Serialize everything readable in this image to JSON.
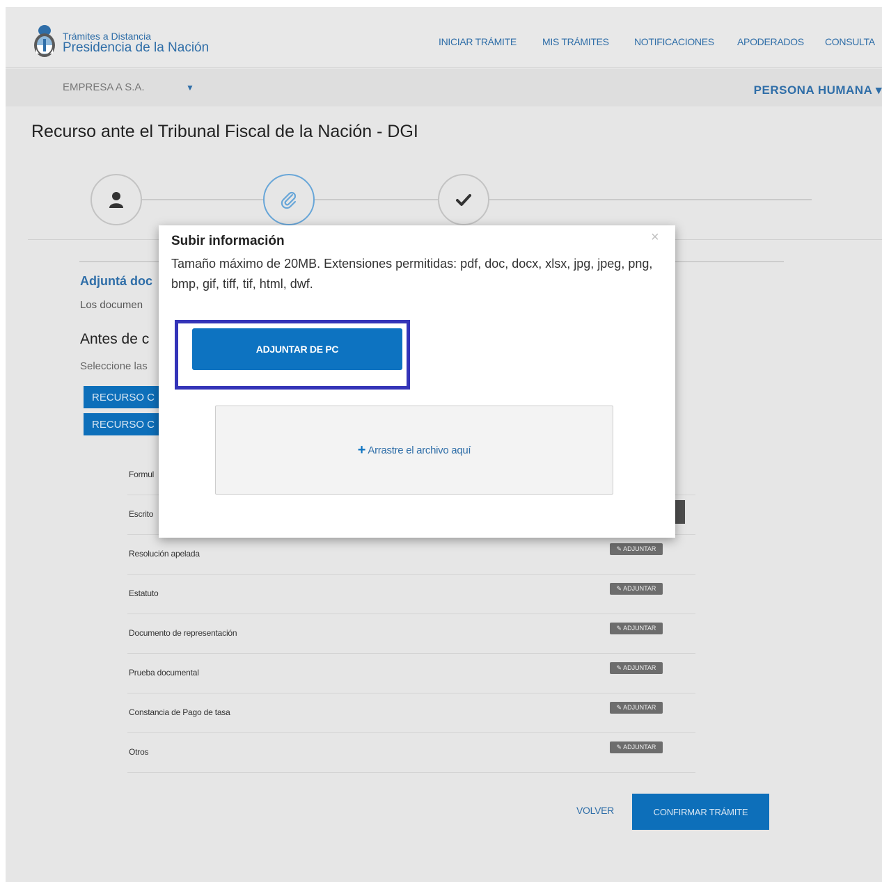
{
  "header": {
    "brand_sub": "Trámites a Distancia",
    "brand_main": "Presidencia de la Nación",
    "nav": [
      {
        "label": "INICIAR TRÁMITE"
      },
      {
        "label": "MIS TRÁMITES"
      },
      {
        "label": "NOTIFICACIONES"
      },
      {
        "label": "APODERADOS"
      },
      {
        "label": "CONSULTA"
      }
    ]
  },
  "subbar": {
    "company": "EMPRESA A S.A.",
    "caret": "▼",
    "persona": "PERSONA HUMANA ▾"
  },
  "page": {
    "title": "Recurso ante el Tribunal Fiscal de la Nación - DGI"
  },
  "steps": [
    {
      "icon": "user-icon",
      "active": false
    },
    {
      "icon": "paperclip-icon",
      "active": true
    },
    {
      "icon": "checkmark-icon",
      "active": false
    }
  ],
  "section": {
    "title": "Adjuntá doc",
    "desc": "Los documen",
    "antes": "Antes de c",
    "select_text": "Seleccione las",
    "recurso_buttons": [
      "RECURSO C",
      "RECURSO C"
    ]
  },
  "documents": [
    {
      "label": "Formul",
      "button": ""
    },
    {
      "label": "Escrito",
      "button": ""
    },
    {
      "label": "Resolución apelada",
      "button": "✎ ADJUNTAR"
    },
    {
      "label": "Estatuto",
      "button": "✎ ADJUNTAR"
    },
    {
      "label": "Documento de representación",
      "button": "✎ ADJUNTAR"
    },
    {
      "label": "Prueba documental",
      "button": "✎ ADJUNTAR"
    },
    {
      "label": "Constancia de Pago de tasa",
      "button": "✎ ADJUNTAR"
    },
    {
      "label": "Otros",
      "button": "✎ ADJUNTAR"
    }
  ],
  "footer": {
    "back_label": "VOLVER",
    "confirm_label": "CONFIRMAR TRÁMITE"
  },
  "modal": {
    "title": "Subir información",
    "close": "×",
    "description": "Tamaño máximo de 20MB. Extensiones permitidas: pdf, doc, docx, xlsx, jpg, jpeg, png, bmp, gif, tiff, tif, html, dwf.",
    "attach_button": "ADJUNTAR DE PC",
    "dropzone_plus": "+",
    "dropzone_text": "Arrastre el archivo aquí"
  },
  "colors": {
    "primary": "#0d73c1",
    "link": "#2f6ea8",
    "highlight": "#3434b8"
  }
}
